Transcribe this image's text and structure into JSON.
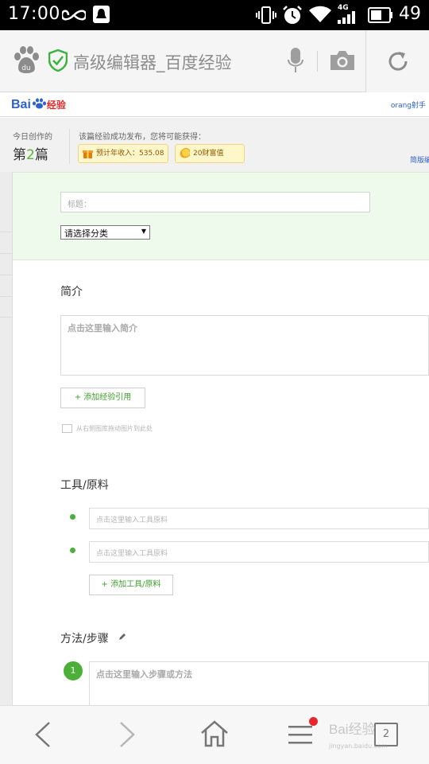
{
  "status_bar": {
    "time": "17:00",
    "battery_level": "49",
    "network": "4G"
  },
  "browser": {
    "page_title": "高级编辑器_百度经验"
  },
  "site": {
    "logo_blue": "Bai",
    "logo_red": "经验",
    "user": "orang射手"
  },
  "stats": {
    "today_label": "今日创作的",
    "today_prefix": "第",
    "today_number": "2",
    "today_suffix": "篇",
    "publish_label": "该篇经验成功发布，您将可能获得：",
    "income_label": "预计年收入：535.08",
    "wealth_label": "20财富值",
    "simple_link": "简版编"
  },
  "editor": {
    "title_placeholder": "标题：",
    "category_selected": "请选择分类",
    "intro_heading": "简介",
    "intro_placeholder": "点击这里输入简介",
    "add_reference_button": "+ 添加经验引用",
    "drag_hint": "从右侧图库拖动图片到此处",
    "tools_heading": "工具/原料",
    "tool_placeholders": [
      "点击这里输入工具原料",
      "点击这里输入工具原料"
    ],
    "add_tool_button": "+ 添加工具/原料",
    "steps_heading": "方法/步骤",
    "step_number": "1",
    "step_placeholder": "点击这里输入步骤或方法"
  },
  "bottom_bar": {
    "tabs_count": "2",
    "watermark": "Bai经验",
    "watermark_sub": "jingyan.baidu.com"
  },
  "colors": {
    "accent_green": "#4cb038",
    "link_blue": "#2e62cc",
    "logo_red": "#e02b2b",
    "notification_red": "#e8262c"
  }
}
